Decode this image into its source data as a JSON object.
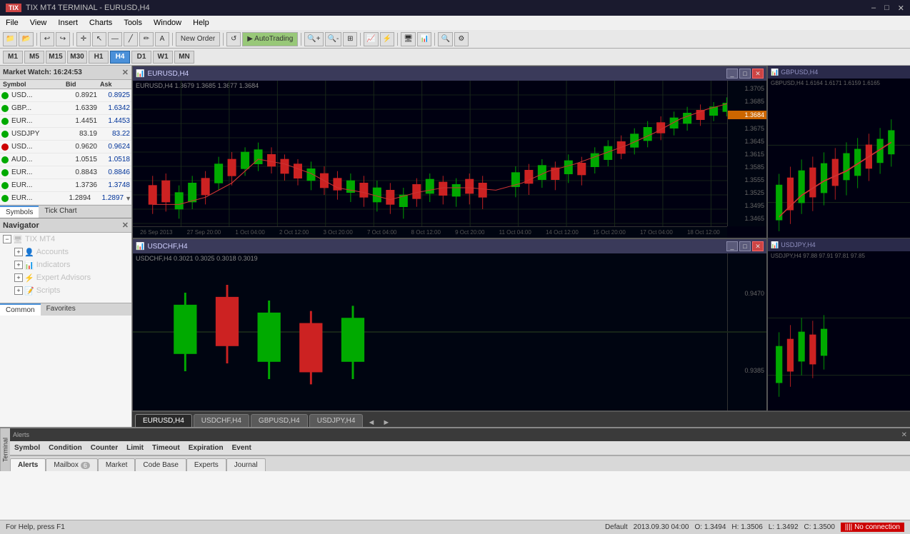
{
  "titlebar": {
    "icon": "TIX",
    "title": "TIX MT4 TERMINAL - EURUSD,H4",
    "min": "–",
    "max": "□",
    "close": "✕"
  },
  "menubar": {
    "items": [
      "File",
      "View",
      "Insert",
      "Charts",
      "Tools",
      "Window",
      "Help"
    ]
  },
  "toolbar1": {
    "buttons": [
      "📁",
      "💾",
      "📂",
      "↩",
      "↪",
      "🖨",
      "🔍+",
      "🔍-",
      "📊",
      "📈",
      "📉",
      "⊞",
      "New Order",
      "AutoTrading",
      "⚡",
      "📌"
    ]
  },
  "toolbar2": {
    "timeframes": [
      "M1",
      "M5",
      "M15",
      "M30",
      "H1",
      "H4",
      "D1",
      "W1",
      "MN"
    ],
    "active": "H4"
  },
  "market_watch": {
    "title": "Market Watch",
    "time": "16:24:53",
    "columns": [
      "Symbol",
      "Bid",
      "Ask"
    ],
    "rows": [
      {
        "symbol": "USD...",
        "bid": "0.8921",
        "ask": "0.8925",
        "dot": "green"
      },
      {
        "symbol": "GBP...",
        "bid": "1.6339",
        "ask": "1.6342",
        "dot": "green"
      },
      {
        "symbol": "EUR...",
        "bid": "1.4451",
        "ask": "1.4453",
        "dot": "green"
      },
      {
        "symbol": "USDJPY",
        "bid": "83.19",
        "ask": "83.22",
        "dot": "green"
      },
      {
        "symbol": "USD...",
        "bid": "0.9620",
        "ask": "0.9624",
        "dot": "red"
      },
      {
        "symbol": "AUD...",
        "bid": "1.0515",
        "ask": "1.0518",
        "dot": "green"
      },
      {
        "symbol": "EUR...",
        "bid": "0.8843",
        "ask": "0.8846",
        "dot": "green"
      },
      {
        "symbol": "EUR...",
        "bid": "1.3736",
        "ask": "1.3748",
        "dot": "green"
      },
      {
        "symbol": "EUR...",
        "bid": "1.2894",
        "ask": "1.2897",
        "dot": "green"
      }
    ],
    "tabs": [
      "Symbols",
      "Tick Chart"
    ]
  },
  "navigator": {
    "title": "Navigator",
    "tree": {
      "root": "TIX MT4",
      "items": [
        {
          "label": "Accounts",
          "icon": "accounts"
        },
        {
          "label": "Indicators",
          "icon": "indicators"
        },
        {
          "label": "Expert Advisors",
          "icon": "experts"
        },
        {
          "label": "Scripts",
          "icon": "scripts"
        }
      ]
    },
    "tabs": [
      "Common",
      "Favorites"
    ]
  },
  "charts": {
    "main": [
      {
        "id": "eurusd_h4",
        "title": "EURUSD,H4",
        "info": "EURUSD,H4 1.3679 1.3685 1.3677 1.3684",
        "tab": "EURUSD,H4"
      },
      {
        "id": "usdchf_h4",
        "title": "USDCHF,H4",
        "info": "USDCHF,H4 0.3021 0.3025 0.3018 0.3019",
        "tab": "USDCHF,H4"
      }
    ],
    "mini": [
      {
        "id": "gbpusd_h4",
        "title": "GBPUSD,H4",
        "info": "GBPUSD,H4 1.6164 1.6171 1.6159 1.6165",
        "tab": "GBPUSD,H4"
      },
      {
        "id": "usdjpy_h4",
        "title": "USDJPY,H4",
        "info": "USDJPY,H4 97.88 97.91 97.81 97.85",
        "tab": "USDJPY,H4"
      }
    ],
    "tabs": [
      "EURUSD,H4",
      "USDCHF,H4",
      "GBPUSD,H4",
      "USDJPY,H4"
    ],
    "active_tab": "EURUSD,H4",
    "prices": {
      "eurusd": {
        "high": "1.3705",
        "levels": [
          "1.3705",
          "1.3685",
          "1.3684",
          "1.3675",
          "1.3645",
          "1.3615",
          "1.3585",
          "1.3555",
          "1.3525",
          "1.3495",
          "1.3465"
        ],
        "current": "1.3684",
        "dates": [
          "26 Sep 2013",
          "27 Sep 20:00",
          "1 Oct 04:00",
          "2 Oct 12:00",
          "3 Oct 20:00",
          "7 Oct 04:00",
          "8 Oct 12:00",
          "9 Oct 20:00",
          "11 Oct 04:00",
          "14 Oct 12:00",
          "15 Oct 20:00",
          "17 Oct 04:00",
          "18 Oct 12:00"
        ]
      },
      "usdchf": {
        "levels": [
          "0.9470",
          "0.9385"
        ]
      }
    }
  },
  "alerts": {
    "columns": [
      "Symbol",
      "Condition",
      "Counter",
      "Limit",
      "Timeout",
      "Expiration",
      "Event"
    ],
    "rows": [],
    "tabs": [
      {
        "label": "Alerts",
        "badge": null
      },
      {
        "label": "Mailbox",
        "badge": "6"
      },
      {
        "label": "Market",
        "badge": null
      },
      {
        "label": "Code Base",
        "badge": null
      },
      {
        "label": "Experts",
        "badge": null
      },
      {
        "label": "Journal",
        "badge": null
      }
    ],
    "active_tab": "Alerts",
    "side_label": "Terminal"
  },
  "statusbar": {
    "help": "For Help, press F1",
    "default": "Default",
    "datetime": "2013.09.30 04:00",
    "open": "O: 1.3494",
    "high": "H: 1.3506",
    "low": "L: 1.3492",
    "close": "C: 1.3500",
    "connection": "No connection"
  }
}
